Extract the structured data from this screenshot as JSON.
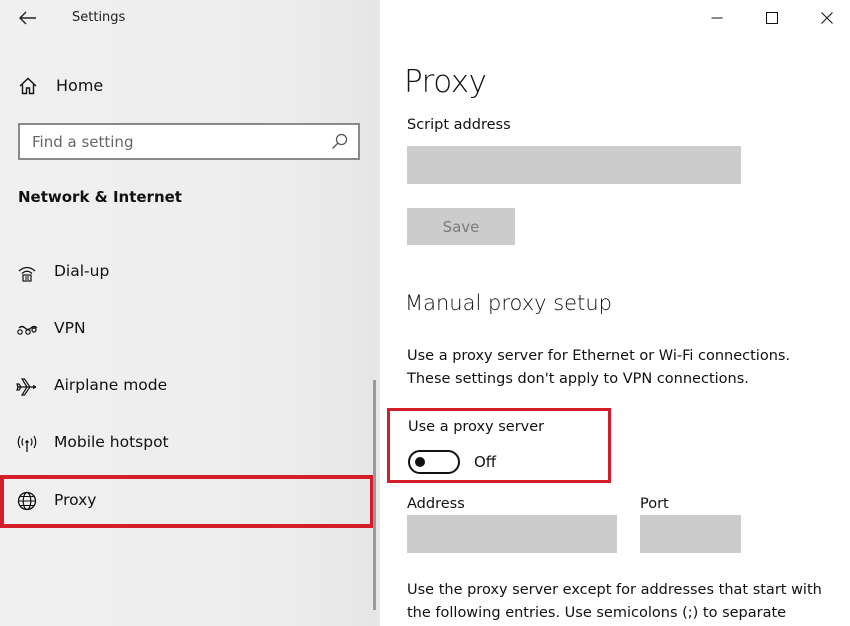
{
  "window": {
    "title": "Settings",
    "controls": {
      "minimize_icon": "minimize-icon",
      "maximize_icon": "maximize-icon",
      "close_icon": "close-icon"
    }
  },
  "sidebar": {
    "home_label": "Home",
    "search": {
      "placeholder": "Find a setting",
      "value": ""
    },
    "section_heading": "Network & Internet",
    "items": [
      {
        "label": "Dial-up",
        "icon": "dialup-icon",
        "selected": false
      },
      {
        "label": "VPN",
        "icon": "vpn-icon",
        "selected": false
      },
      {
        "label": "Airplane mode",
        "icon": "airplane-icon",
        "selected": false
      },
      {
        "label": "Mobile hotspot",
        "icon": "hotspot-icon",
        "selected": false
      },
      {
        "label": "Proxy",
        "icon": "globe-icon",
        "selected": true
      }
    ]
  },
  "main": {
    "title": "Proxy",
    "script_address": {
      "label": "Script address",
      "value": ""
    },
    "save_label": "Save",
    "manual_heading": "Manual proxy setup",
    "manual_description_line1": "Use a proxy server for Ethernet or Wi-Fi connections.",
    "manual_description_line2": "These settings don't apply to VPN connections.",
    "use_proxy": {
      "label": "Use a proxy server",
      "state": "Off",
      "on": false
    },
    "address": {
      "label": "Address",
      "value": ""
    },
    "port": {
      "label": "Port",
      "value": ""
    },
    "exceptions_line1": "Use the proxy server except for addresses that start with",
    "exceptions_line2": "the following entries. Use semicolons (;) to separate"
  },
  "colors": {
    "highlight": "#d41f2b",
    "field_bg": "#cccccc",
    "sidebar_bg": "#eeeeee"
  }
}
